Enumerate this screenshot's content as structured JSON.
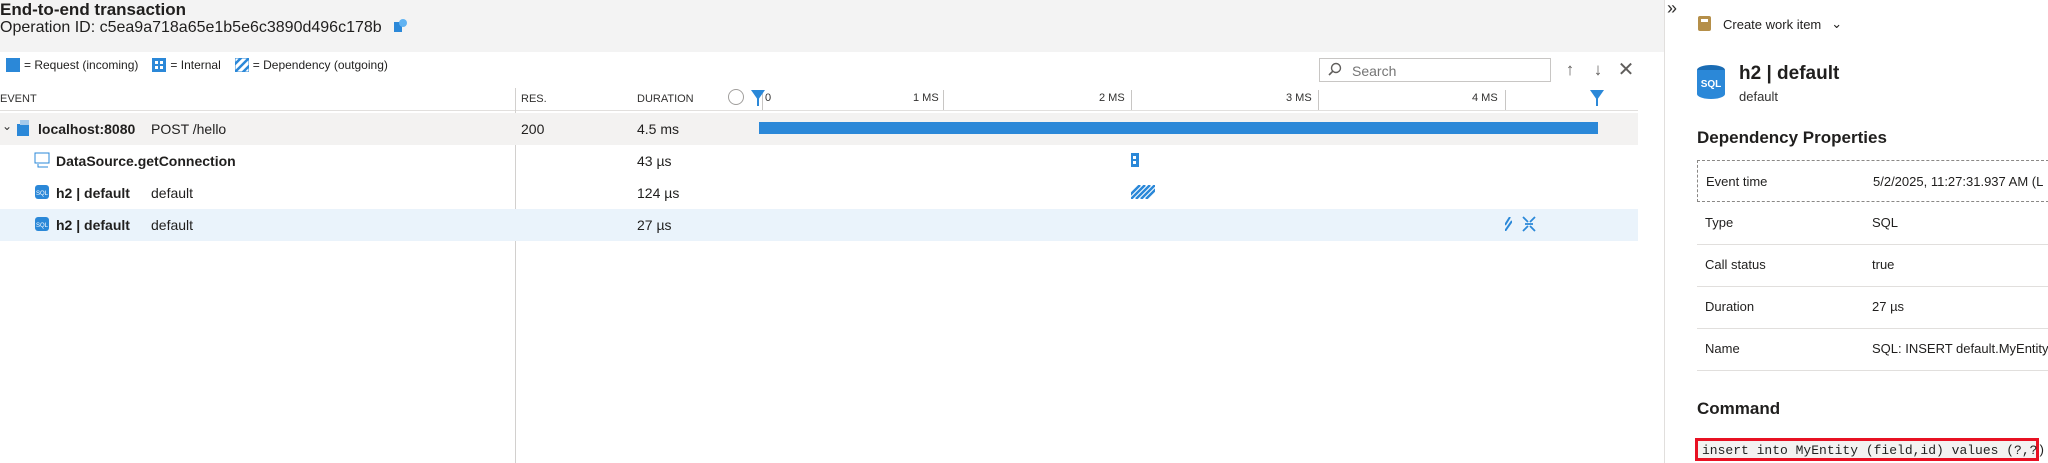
{
  "header": {
    "title": "End-to-end transaction",
    "operation_id": "Operation ID: c5ea9a718a65e1b5e6c3890d496c178b"
  },
  "legend": {
    "request": "= Request (incoming)",
    "internal": "= Internal",
    "dependency": "= Dependency (outgoing)"
  },
  "search": {
    "placeholder": "Search"
  },
  "columns": {
    "event": "EVENT",
    "res": "RES.",
    "duration": "DURATION"
  },
  "timeline_ticks": [
    "0",
    "1 MS",
    "2 MS",
    "3 MS",
    "4 MS"
  ],
  "rows": [
    {
      "name": "localhost:8080",
      "detail": "POST /hello",
      "res": "200",
      "duration": "4.5 ms"
    },
    {
      "name": "DataSource.getConnection",
      "detail": "",
      "res": "",
      "duration": "43 µs"
    },
    {
      "name": "h2 | default",
      "detail": "default",
      "res": "",
      "duration": "124 µs"
    },
    {
      "name": "h2 | default",
      "detail": "default",
      "res": "",
      "duration": "27 µs"
    }
  ],
  "panel": {
    "create_work_item": "Create work item",
    "title": "h2 | default",
    "subtitle": "default",
    "sql_badge": "SQL",
    "section_properties": "Dependency Properties",
    "properties": [
      {
        "key": "Event time",
        "value": "5/2/2025, 11:27:31.937 AM (L"
      },
      {
        "key": "Type",
        "value": "SQL"
      },
      {
        "key": "Call status",
        "value": "true"
      },
      {
        "key": "Duration",
        "value": "27 µs"
      },
      {
        "key": "Name",
        "value": "SQL: INSERT default.MyEntity"
      }
    ],
    "section_command": "Command",
    "command": "insert into MyEntity (field,id) values (?,?)"
  },
  "colors": {
    "accent": "#2b88d8",
    "highlight_row": "#eaf3fb",
    "command_border": "#e81123"
  },
  "icons": [
    "expand-panel-icon",
    "copy-operation-icon",
    "search-icon",
    "arrow-up-icon",
    "arrow-down-icon",
    "close-icon",
    "chevron-down-icon",
    "work-item-icon",
    "sql-database-icon",
    "internal-dependency-icon",
    "request-icon",
    "time-cursor-icon"
  ]
}
